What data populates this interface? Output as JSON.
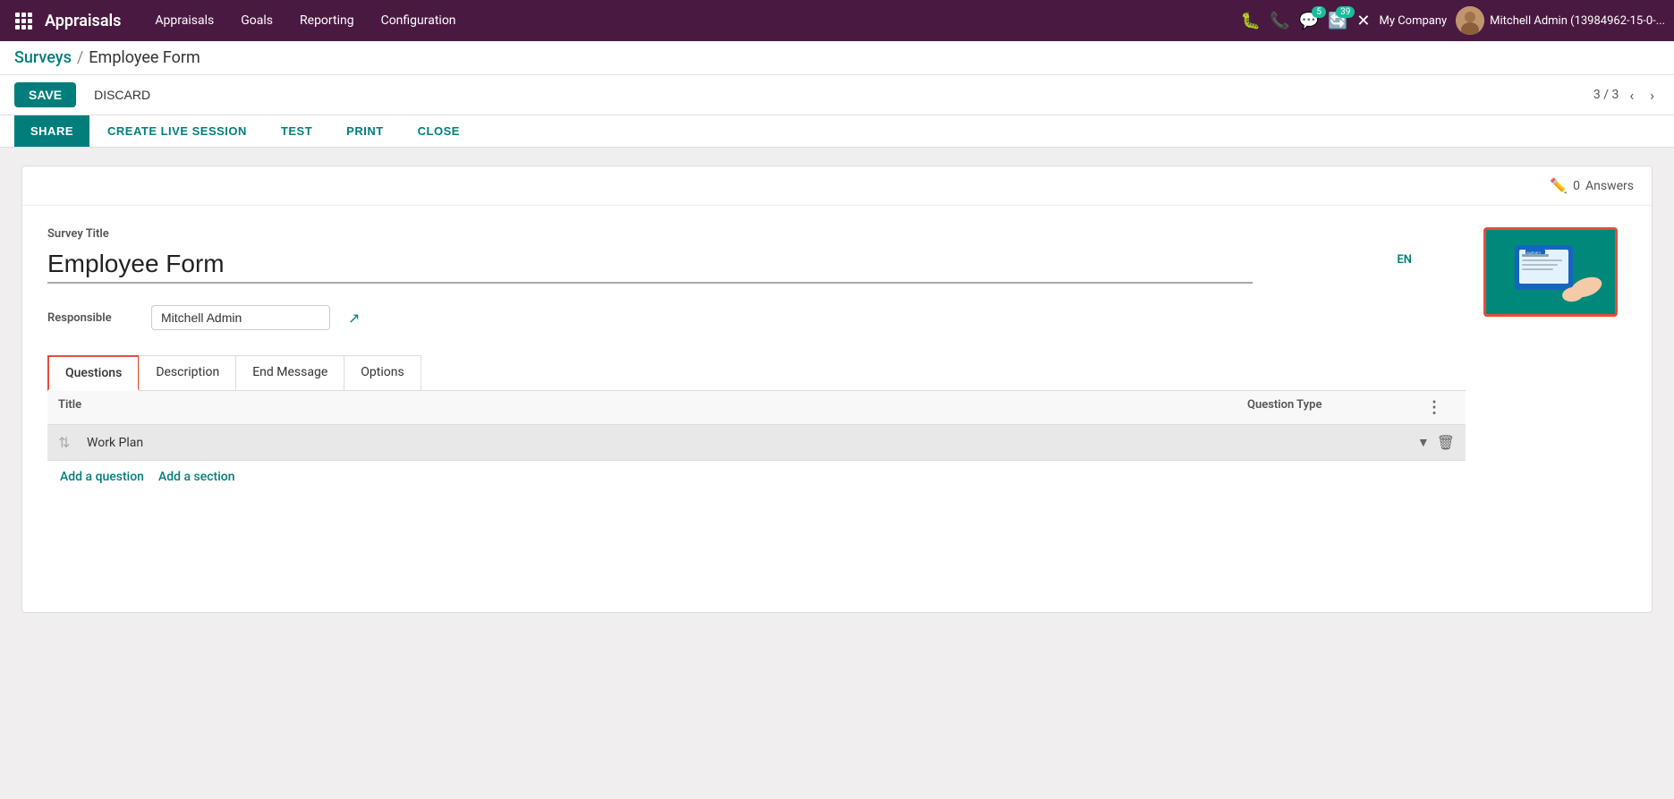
{
  "app": {
    "title": "Appraisals",
    "grid_icon": "⊞"
  },
  "nav": {
    "items": [
      {
        "label": "Appraisals",
        "id": "appraisals"
      },
      {
        "label": "Goals",
        "id": "goals"
      },
      {
        "label": "Reporting",
        "id": "reporting"
      },
      {
        "label": "Configuration",
        "id": "configuration"
      }
    ]
  },
  "topnav_right": {
    "bug_icon": "🐛",
    "phone_icon": "📞",
    "chat_count": "5",
    "activity_count": "39",
    "close_icon": "✕",
    "company": "My Company",
    "user": "Mitchell Admin (13984962-15-0-..."
  },
  "breadcrumb": {
    "parent": "Surveys",
    "separator": "/",
    "current": "Employee Form"
  },
  "toolbar": {
    "save_label": "SAVE",
    "discard_label": "DISCARD",
    "pagination": "3 / 3"
  },
  "sharebar": {
    "share_label": "SHARE",
    "create_live_label": "CREATE LIVE SESSION",
    "test_label": "TEST",
    "print_label": "PRINT",
    "close_label": "CLOSE"
  },
  "form": {
    "answers_count": "0",
    "answers_label": "Answers",
    "survey_title_label": "Survey Title",
    "survey_title": "Employee Form",
    "lang": "EN",
    "responsible_label": "Responsible",
    "responsible_value": "Mitchell Admin"
  },
  "tabs": [
    {
      "label": "Questions",
      "id": "questions",
      "active": true
    },
    {
      "label": "Description",
      "id": "description",
      "active": false
    },
    {
      "label": "End Message",
      "id": "end-message",
      "active": false
    },
    {
      "label": "Options",
      "id": "options",
      "active": false
    }
  ],
  "table": {
    "col_title": "Title",
    "col_question_type": "Question Type",
    "sections": [
      {
        "title": "Work Plan",
        "id": "work-plan"
      }
    ],
    "add_question_label": "Add a question",
    "add_section_label": "Add a section"
  }
}
